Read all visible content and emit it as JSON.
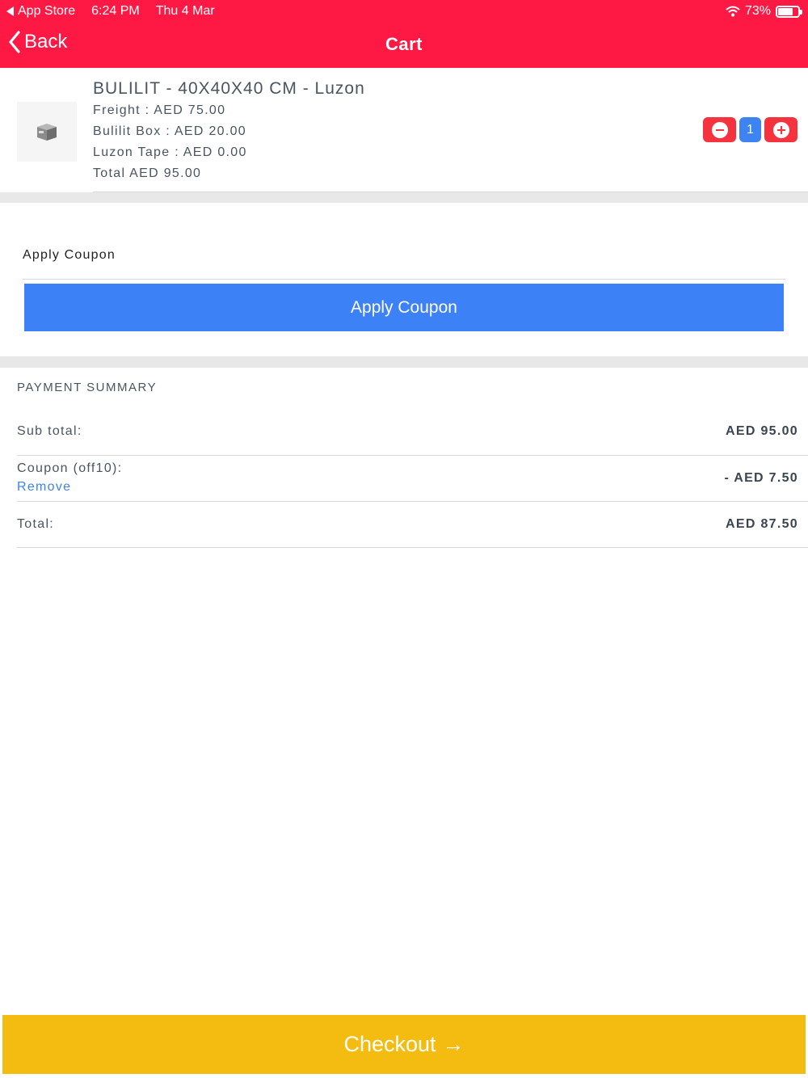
{
  "status_bar": {
    "back_app": "App Store",
    "time": "6:24 PM",
    "date": "Thu 4 Mar",
    "battery_percent": "73%",
    "battery_level": 0.73
  },
  "nav": {
    "back_label": "Back",
    "title": "Cart"
  },
  "cart_item": {
    "title": "BULILIT - 40X40X40 CM - Luzon",
    "lines": [
      "Freight : AED 75.00",
      "Bulilit Box : AED 20.00",
      "Luzon Tape : AED 0.00",
      "Total AED 95.00"
    ],
    "quantity": "1"
  },
  "coupon": {
    "label": "Apply Coupon",
    "button_label": "Apply Coupon"
  },
  "summary": {
    "heading": "PAYMENT SUMMARY",
    "subtotal_label": "Sub total:",
    "subtotal_value": "AED 95.00",
    "coupon_label": "Coupon (off10):",
    "coupon_remove": "Remove",
    "coupon_value": "- AED 7.50",
    "total_label": "Total:",
    "total_value": "AED 87.50"
  },
  "checkout": {
    "label": "Checkout",
    "arrow": "→"
  },
  "colors": {
    "header": "#fe1844",
    "primary_blue": "#3d81f7",
    "stepper_red": "#f4333e",
    "checkout_yellow": "#f4bc10"
  }
}
